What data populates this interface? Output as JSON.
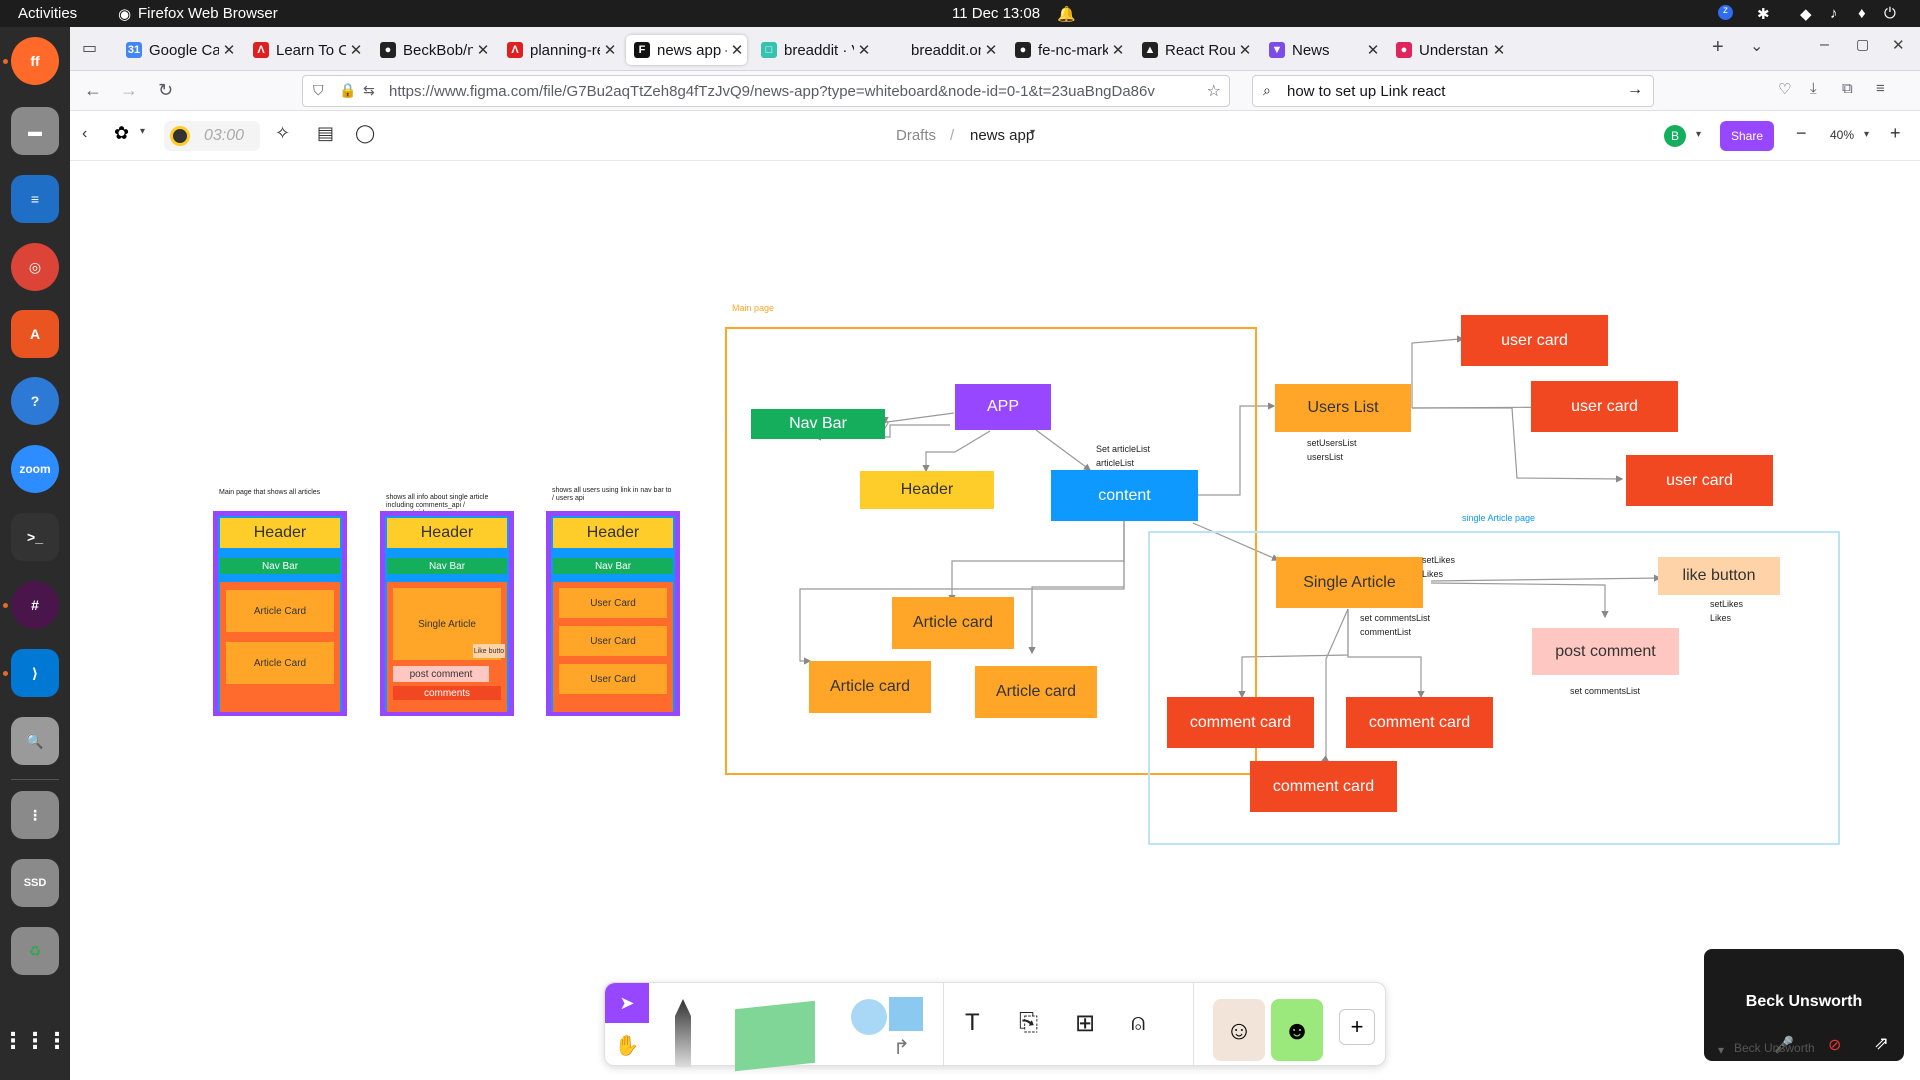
{
  "system": {
    "activities": "Activities",
    "app_name": "Firefox Web Browser",
    "clock": "11 Dec  13:08"
  },
  "tabs": [
    {
      "title": "Google Calen",
      "favcolor": "#4285f4",
      "glyph": "31"
    },
    {
      "title": "Learn To Cod",
      "favcolor": "#e02020",
      "glyph": "Λ"
    },
    {
      "title": "BeckBob/nc",
      "favcolor": "#222222",
      "glyph": "●"
    },
    {
      "title": "planning-rea",
      "favcolor": "#e02020",
      "glyph": "Λ"
    },
    {
      "title": "news app – F",
      "favcolor": "#111111",
      "glyph": "F"
    },
    {
      "title": "breaddit  · V",
      "favcolor": "#35c2b0",
      "glyph": "□"
    },
    {
      "title": "breaddit.onrend",
      "favcolor": "#f0f0f4",
      "glyph": ""
    },
    {
      "title": "fe-nc-market",
      "favcolor": "#222222",
      "glyph": "●"
    },
    {
      "title": "React Router",
      "favcolor": "#222222",
      "glyph": "▲"
    },
    {
      "title": "News",
      "favcolor": "#7b4de6",
      "glyph": "▼"
    },
    {
      "title": "Understandi",
      "favcolor": "#e0245e",
      "glyph": "●"
    }
  ],
  "url": "https://www.figma.com/file/G7Bu2aqTtZeh8g4fTzJvQ9/news-app?type=whiteboard&node-id=0-1&t=23uaBngDa86v",
  "url_domain": "figma.com",
  "search": "how to set up Link react",
  "figma": {
    "timer": "03:00",
    "breadcrumb_root": "Drafts",
    "separator": "/",
    "file_name": "news app",
    "avatar": "B",
    "share": "Share",
    "zoom": "40%"
  },
  "canvas": {
    "main_page_label": "Main page",
    "single_article_label": "single Article page",
    "wire_notes": [
      "Main page that shows all articles",
      "shows all info about single article including comments_api / comment_id",
      "shows all users using link in nav bar to / users api"
    ],
    "wire1": {
      "header": "Header",
      "nav": "Nav Bar",
      "cards": [
        "Article Card",
        "Article Card"
      ]
    },
    "wire2": {
      "header": "Header",
      "nav": "Nav Bar",
      "article": "Single Article",
      "like": "Like butto",
      "post": "post comment",
      "comments": "comments"
    },
    "wire3": {
      "header": "Header",
      "nav": "Nav Bar",
      "cards": [
        "User Card",
        "User Card",
        "User Card"
      ]
    },
    "nodes": {
      "nav_bar": "Nav Bar",
      "app": "APP",
      "header": "Header",
      "content": "content",
      "article_card_1": "Article card",
      "article_card_2": "Article card",
      "article_card_3": "Article card",
      "users_list": "Users List",
      "user_card_1": "user card",
      "user_card_2": "user card",
      "user_card_3": "user card",
      "single_article": "Single Article",
      "like_button": "like button",
      "post_comment": "post comment",
      "comment_card_1": "comment card",
      "comment_card_2": "comment card",
      "comment_card_3": "comment card"
    },
    "annotations": {
      "set_article": "Set articleList",
      "article_list": "articleList",
      "set_users": "setUsersList",
      "users_list": "usersList",
      "set_likes_a": "setLikes",
      "likes_a": "Likes",
      "set_comments": "set commentsList",
      "comment_list": "commentList",
      "set_likes_b": "setLikes",
      "likes_b": "Likes",
      "set_comments_b": "set commentsList"
    }
  },
  "zoom_call": {
    "name": "Beck Unsworth",
    "name_faded": "Beck Unsworth"
  },
  "colors": {
    "purple": "#9747ff",
    "green": "#14ae5c",
    "yellow": "#ffcd29",
    "blue": "#0d99ff",
    "orange": "#ffa629",
    "red": "#f24822",
    "peach": "#ffd3a8",
    "pink": "#ffc7c2"
  }
}
